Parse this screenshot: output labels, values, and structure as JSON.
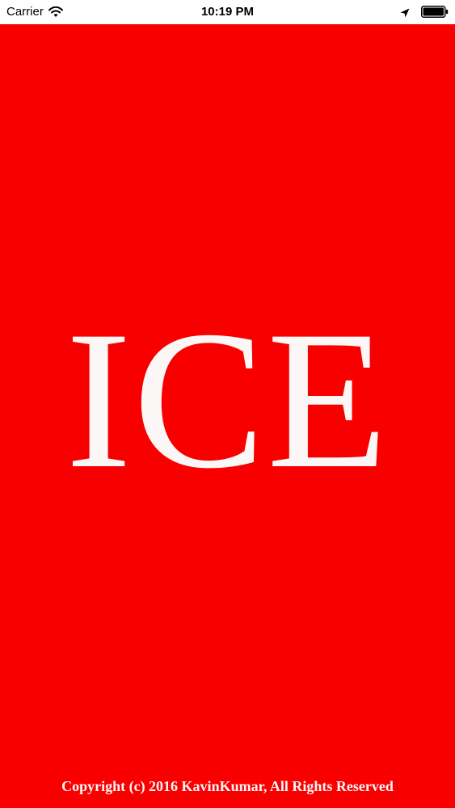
{
  "status_bar": {
    "carrier": "Carrier",
    "time": "10:19 PM",
    "icons": [
      "wifi-icon",
      "location-icon",
      "battery-icon"
    ]
  },
  "splash": {
    "logo_text": "ICE",
    "copyright": "Copyright (c) 2016 KavinKumar, All Rights Reserved"
  },
  "colors": {
    "background": "#f90000",
    "text": "#fbf7f7",
    "status_bar_bg": "#ffffff"
  }
}
